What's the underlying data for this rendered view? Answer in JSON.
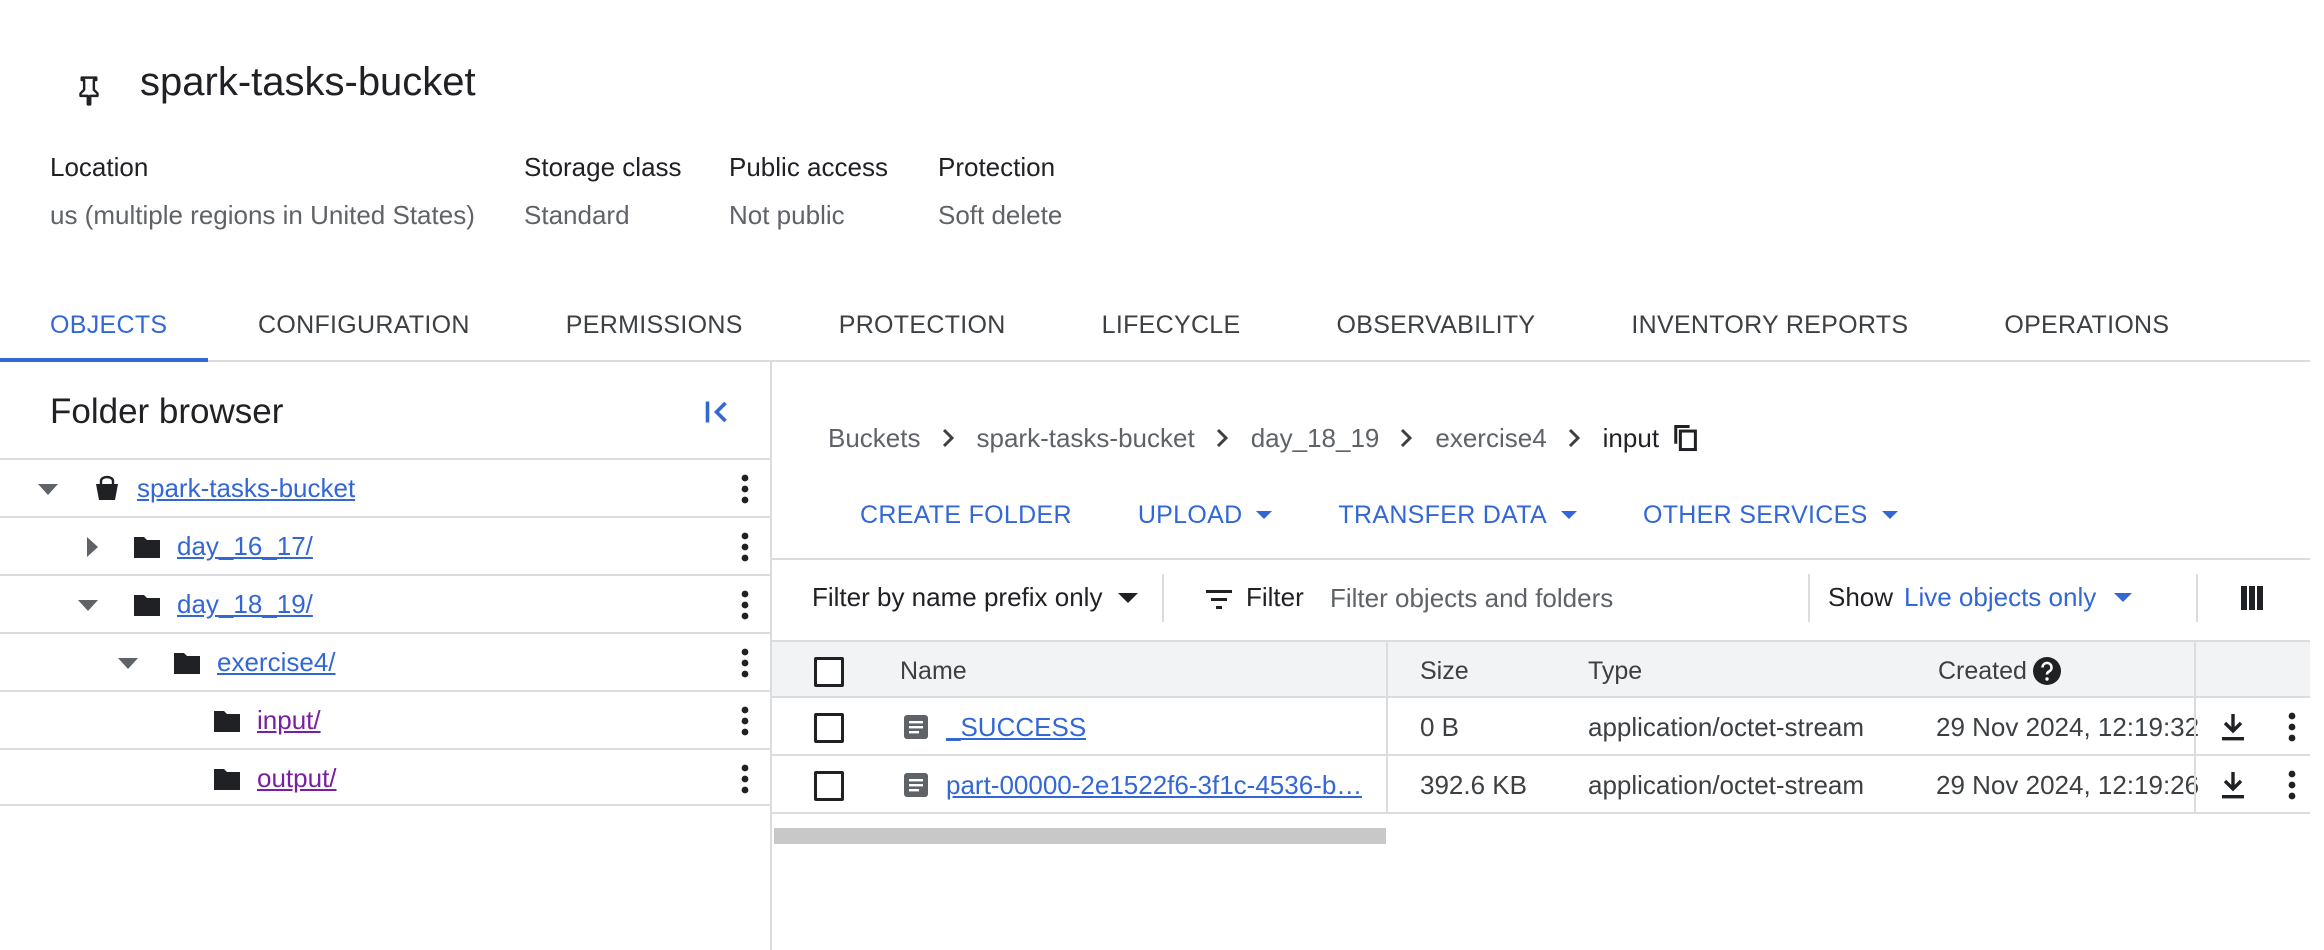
{
  "bucket": {
    "name": "spark-tasks-bucket",
    "meta": [
      {
        "label": "Location",
        "value": "us (multiple regions in United States)"
      },
      {
        "label": "Storage class",
        "value": "Standard"
      },
      {
        "label": "Public access",
        "value": "Not public"
      },
      {
        "label": "Protection",
        "value": "Soft delete"
      }
    ]
  },
  "tabs": [
    "OBJECTS",
    "CONFIGURATION",
    "PERMISSIONS",
    "PROTECTION",
    "LIFECYCLE",
    "OBSERVABILITY",
    "INVENTORY REPORTS",
    "OPERATIONS"
  ],
  "active_tab": "OBJECTS",
  "folder_browser": {
    "title": "Folder browser",
    "items": [
      {
        "label": "spark-tasks-bucket"
      },
      {
        "label": "day_16_17/"
      },
      {
        "label": "day_18_19/"
      },
      {
        "label": "exercise4/"
      },
      {
        "label": "input/"
      },
      {
        "label": "output/"
      }
    ]
  },
  "breadcrumb": [
    "Buckets",
    "spark-tasks-bucket",
    "day_18_19",
    "exercise4",
    "input"
  ],
  "actions": {
    "create_folder": "CREATE FOLDER",
    "upload": "UPLOAD",
    "transfer_data": "TRANSFER DATA",
    "other_services": "OTHER SERVICES"
  },
  "filter": {
    "prefix_mode": "Filter by name prefix only",
    "label": "Filter",
    "placeholder": "Filter objects and folders",
    "show_label": "Show",
    "show_value": "Live objects only"
  },
  "table": {
    "headers": {
      "name": "Name",
      "size": "Size",
      "type": "Type",
      "created": "Created"
    },
    "rows": [
      {
        "name": "_SUCCESS",
        "size": "0 B",
        "type": "application/octet-stream",
        "created": "29 Nov 2024, 12:19:32"
      },
      {
        "name": "part-00000-2e1522f6-3f1c-4536-b…",
        "size": "392.6 KB",
        "type": "application/octet-stream",
        "created": "29 Nov 2024, 12:19:26"
      }
    ]
  },
  "colors": {
    "accent": "#3367d6",
    "visited": "#7b1fa2",
    "border": "#dadce0"
  }
}
